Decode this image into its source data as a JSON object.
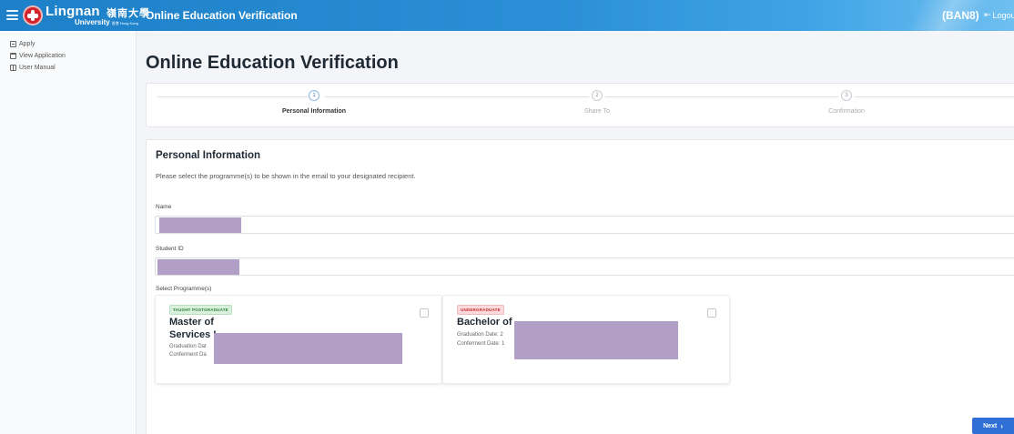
{
  "header": {
    "logo_name": "Lingnan",
    "logo_cjk": "嶺南大學",
    "logo_sub": "University",
    "logo_sub_small": "香港 Hong Kong",
    "app_title": "Online Education Verification",
    "user_code": "(BAN8)",
    "logout_label": "Logou",
    "logout_icon": "logout-icon"
  },
  "sidebar": {
    "items": [
      {
        "label": "Apply",
        "icon": "apply-icon"
      },
      {
        "label": "View Application",
        "icon": "view-application-icon"
      },
      {
        "label": "User Manual",
        "icon": "user-manual-icon"
      }
    ]
  },
  "page": {
    "title": "Online Education Verification"
  },
  "stepper": {
    "steps": [
      {
        "number": "1",
        "label": "Personal Information",
        "active": true
      },
      {
        "number": "2",
        "label": "Share To",
        "active": false
      },
      {
        "number": "3",
        "label": "Confirmation",
        "active": false
      }
    ]
  },
  "form": {
    "section_title": "Personal Information",
    "description": "Please select the programme(s) to be shown in the email to your designated recipient.",
    "name_label": "Name",
    "student_id_label": "Student ID",
    "programmes_label": "Select Programme(s)",
    "programmes": [
      {
        "badge": "TAUGHT POSTGRADUATE",
        "title_line1": "Master of",
        "title_line2": "Services I",
        "graduation": "Graduation Dat",
        "conferment": "Conferment Da",
        "checked": false
      },
      {
        "badge": "UNDERGRADUATE",
        "title_line1": "Bachelor of",
        "graduation": "Graduation Date: 2",
        "conferment": "Conferment Date: 1",
        "checked": false
      }
    ]
  },
  "actions": {
    "next_label": "Next",
    "next_icon": "chevron-right-icon"
  },
  "colors": {
    "header": "#1d80c8",
    "primary_button": "#2f6fd6",
    "redaction": "#b29fc8",
    "badge_tpg": "#d8f0dc",
    "badge_ug": "#fbd9dc"
  }
}
